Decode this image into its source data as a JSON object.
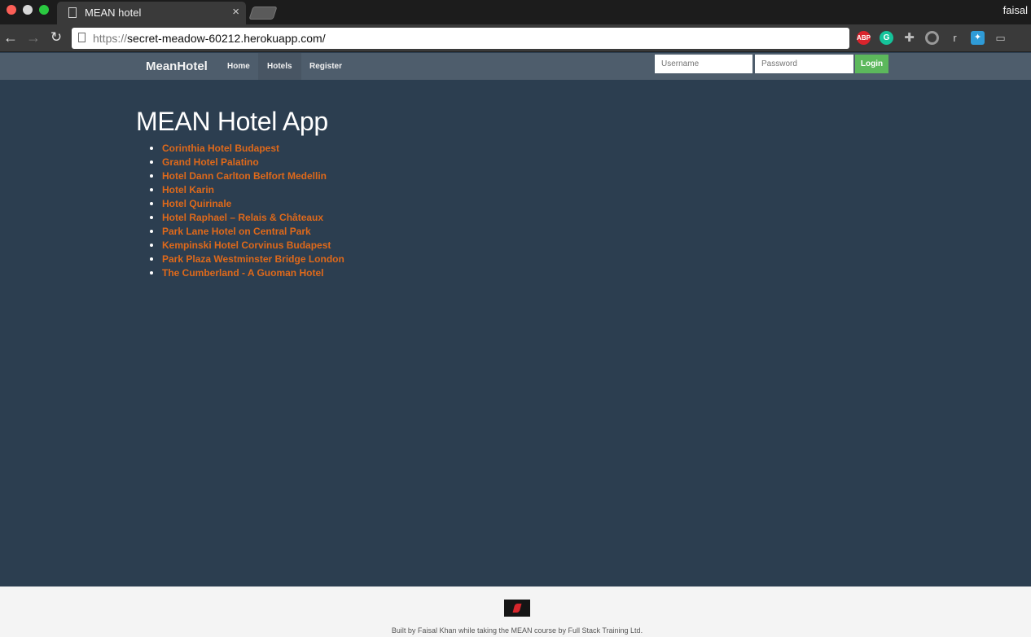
{
  "browser": {
    "tab_title": "MEAN hotel",
    "tab_close": "×",
    "profile_name": "faisal",
    "url_scheme": "https://",
    "url_host": "secret-meadow-60212.herokuapp.com/",
    "back_icon": "←",
    "forward_icon": "→",
    "reload_icon": "↻",
    "extensions": {
      "abp": "ABP",
      "grammarly": "G",
      "puzzle": "✚",
      "r": "r",
      "compass": "✦",
      "cast": "▭"
    }
  },
  "navbar": {
    "brand": "MeanHotel",
    "links": {
      "home": "Home",
      "hotels": "Hotels",
      "register": "Register"
    },
    "username_placeholder": "Username",
    "password_placeholder": "Password",
    "login_label": "Login"
  },
  "main": {
    "title": "MEAN Hotel App",
    "hotels": [
      "Corinthia Hotel Budapest",
      "Grand Hotel Palatino",
      "Hotel Dann Carlton Belfort Medellin",
      "Hotel Karin",
      "Hotel Quirinale",
      "Hotel Raphael – Relais & Châteaux",
      "Park Lane Hotel on Central Park",
      "Kempinski Hotel Corvinus Budapest",
      "Park Plaza Westminster Bridge London",
      "The Cumberland - A Guoman Hotel"
    ]
  },
  "footer": {
    "text": "Built by Faisal Khan while taking the MEAN course by Full Stack Training Ltd."
  },
  "colors": {
    "background": "#2c3e50",
    "navbar": "#4e5d6c",
    "link": "#df691a",
    "login_button": "#5cb85c"
  }
}
